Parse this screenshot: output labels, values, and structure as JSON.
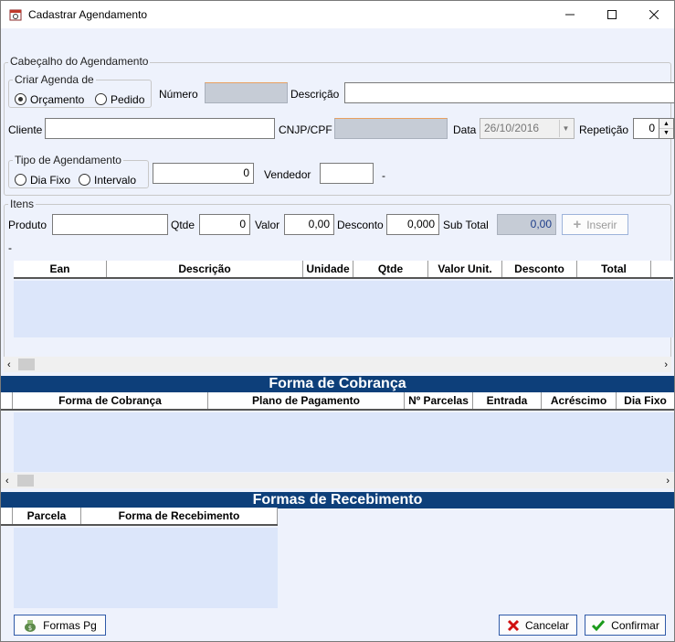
{
  "window": {
    "title": "Cadastrar Agendamento"
  },
  "header_group": {
    "label": "Cabeçalho do Agendamento",
    "agenda_group": {
      "label": "Criar Agenda de",
      "option1": "Orçamento",
      "option2": "Pedido"
    },
    "numero_label": "Número",
    "descricao_label": "Descrição",
    "cliente_label": "Cliente",
    "cnpj_label": "CNJP/CPF",
    "data_label": "Data",
    "data_value": "26/10/2016",
    "repeticao_label": "Repetição",
    "repeticao_value": "0",
    "tipo_group": {
      "label": "Tipo de Agendamento",
      "option1": "Dia Fixo",
      "option2": "Intervalo"
    },
    "intervalo_value": "0",
    "vendedor_label": "Vendedor",
    "dash": "-"
  },
  "itens_group": {
    "label": "Itens",
    "produto_label": "Produto",
    "qtde_label": "Qtde",
    "qtde_value": "0",
    "valor_label": "Valor",
    "valor_value": "0,00",
    "desconto_label": "Desconto",
    "desconto_value": "0,000",
    "subtotal_label": "Sub Total",
    "subtotal_value": "0,00",
    "inserir_label": "Inserir",
    "dash": "-",
    "columns": [
      "Ean",
      "Descrição",
      "Unidade",
      "Qtde",
      "Valor Unit.",
      "Desconto",
      "Total"
    ]
  },
  "cobranca": {
    "title": "Forma de Cobrança",
    "columns": [
      "Forma de Cobrança",
      "Plano de Pagamento",
      "Nº Parcelas",
      "Entrada",
      "Acréscimo",
      "Dia Fixo"
    ]
  },
  "recebimento": {
    "title": "Formas de Recebimento",
    "columns": [
      "Parcela",
      "Forma de Recebimento"
    ]
  },
  "buttons": {
    "formas_pg": "Formas Pg",
    "cancelar": "Cancelar",
    "confirmar": "Confirmar"
  },
  "colors": {
    "section_bg": "#0d3f7a",
    "grid_bg": "#dce6fa",
    "client_bg": "#eef2fc"
  }
}
